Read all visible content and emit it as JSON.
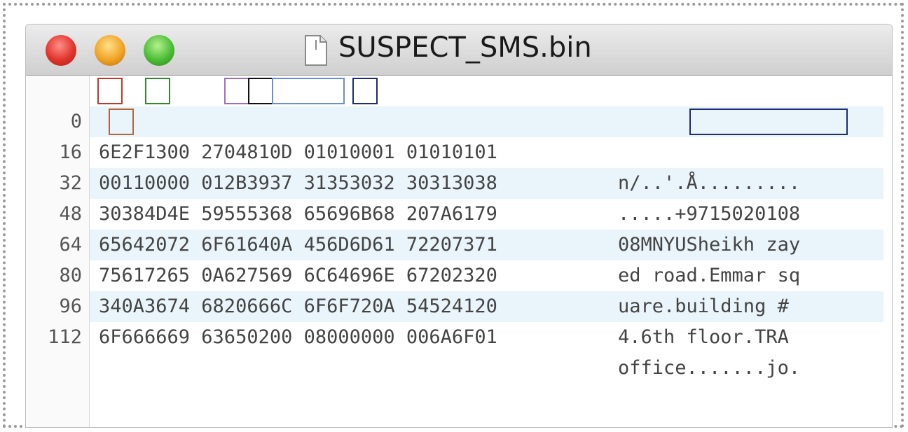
{
  "window": {
    "title": "SUSPECT_SMS.bin",
    "icons": {
      "close": "close-light-icon",
      "minimize": "minimize-light-icon",
      "zoom": "zoom-light-icon",
      "file": "document-icon"
    },
    "colors": {
      "close": "#e0342c",
      "minimize": "#f1a325",
      "zoom": "#4cbd36"
    }
  },
  "hexview": {
    "rows": [
      {
        "offset": "0",
        "hex": "6E2F1300 2704810D 01010001 01010101",
        "ascii": "n/..'.Å........."
      },
      {
        "offset": "16",
        "hex": "00110000 012B3937 31353032 30313038",
        "ascii": ".....+9715020108"
      },
      {
        "offset": "32",
        "hex": "30384D4E 59555368 65696B68 207A6179",
        "ascii": "08MNYUSheikh zay"
      },
      {
        "offset": "48",
        "hex": "65642072 6F61640A 456D6D61 72207371",
        "ascii": "ed road.Emmar sq"
      },
      {
        "offset": "64",
        "hex": "75617265 0A627569 6C64696E 67202320",
        "ascii": "uare.building # "
      },
      {
        "offset": "80",
        "hex": "340A3674 6820666C 6F6F720A 54524120",
        "ascii": "4.6th floor.TRA "
      },
      {
        "offset": "96",
        "hex": "6F666669 63650200 08000000 006A6F01",
        "ascii": "office.......jo."
      },
      {
        "offset": "112",
        "hex": "",
        "ascii": ""
      }
    ],
    "highlight_colors": [
      "#c0392b",
      "#2e8b2e",
      "#9b6fc8",
      "#111111",
      "#6b8fd6",
      "#1f2a7a",
      "#b5653a"
    ]
  }
}
